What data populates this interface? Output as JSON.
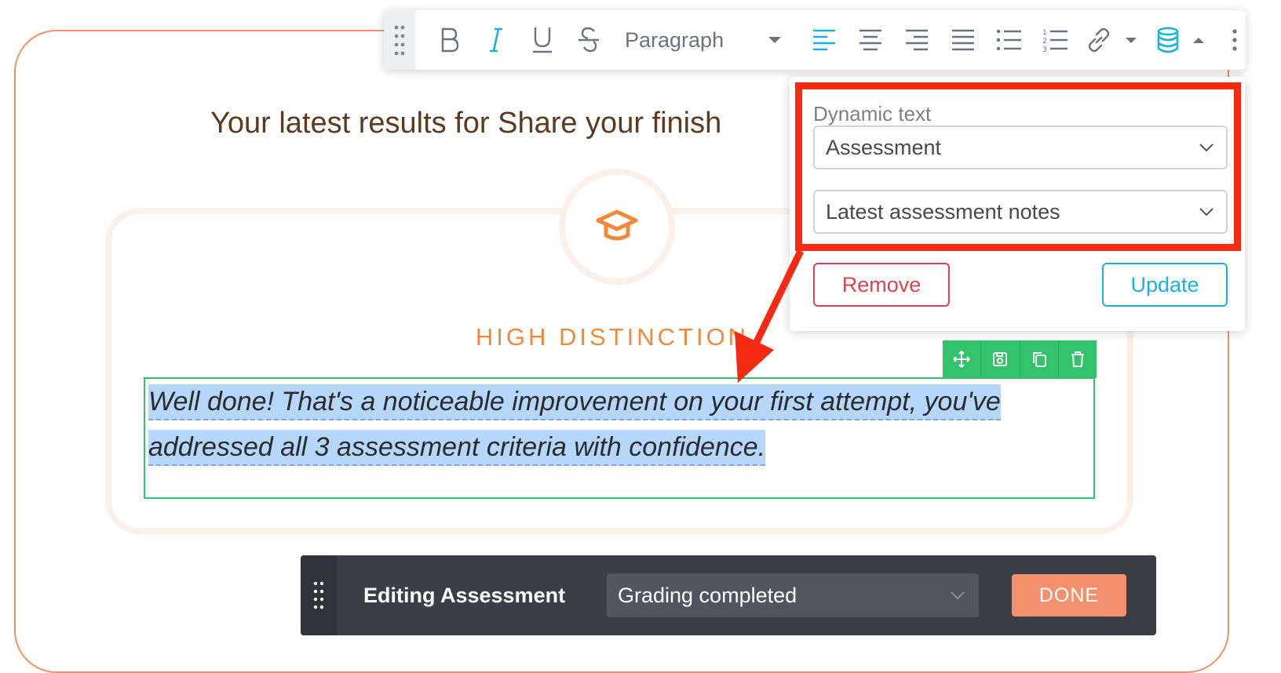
{
  "page": {
    "heading": "Your latest results for Share your finish",
    "grade_title": "HIGH DISTINCTION",
    "notes_line1": "Well done! That's a noticeable improvement on your first attempt, you've",
    "notes_line2": "addressed all 3 assessment criteria with confidence."
  },
  "toolbar": {
    "format_select": "Paragraph",
    "buttons": [
      "bold-icon",
      "italic-icon",
      "underline-icon",
      "strikethrough-icon",
      "align-left-icon",
      "align-center-icon",
      "align-right-icon",
      "align-justify-icon",
      "bullet-list-icon",
      "numbered-list-icon",
      "link-icon",
      "database-icon",
      "more-icon"
    ],
    "numbered_list_digits": [
      "1",
      "2",
      "3"
    ]
  },
  "popover": {
    "label": "Dynamic text",
    "source_select": "Assessment",
    "field_select": "Latest assessment notes",
    "remove_label": "Remove",
    "update_label": "Update"
  },
  "block_actions": [
    "move-icon",
    "save-icon",
    "copy-icon",
    "trash-icon"
  ],
  "edit_bar": {
    "title": "Editing Assessment",
    "status_select": "Grading completed",
    "done_label": "DONE"
  },
  "colors": {
    "accent_orange": "#f08a3a",
    "frame_orange": "#f0906a",
    "toolbar_active": "#1ab0e0",
    "block_green": "#33c36b",
    "highlight_red": "#f52a12",
    "remove_red": "#e0414f",
    "selection_blue": "#b5d7fc",
    "bar_dark": "#3a3e47",
    "done_salmon": "#f4906e"
  }
}
